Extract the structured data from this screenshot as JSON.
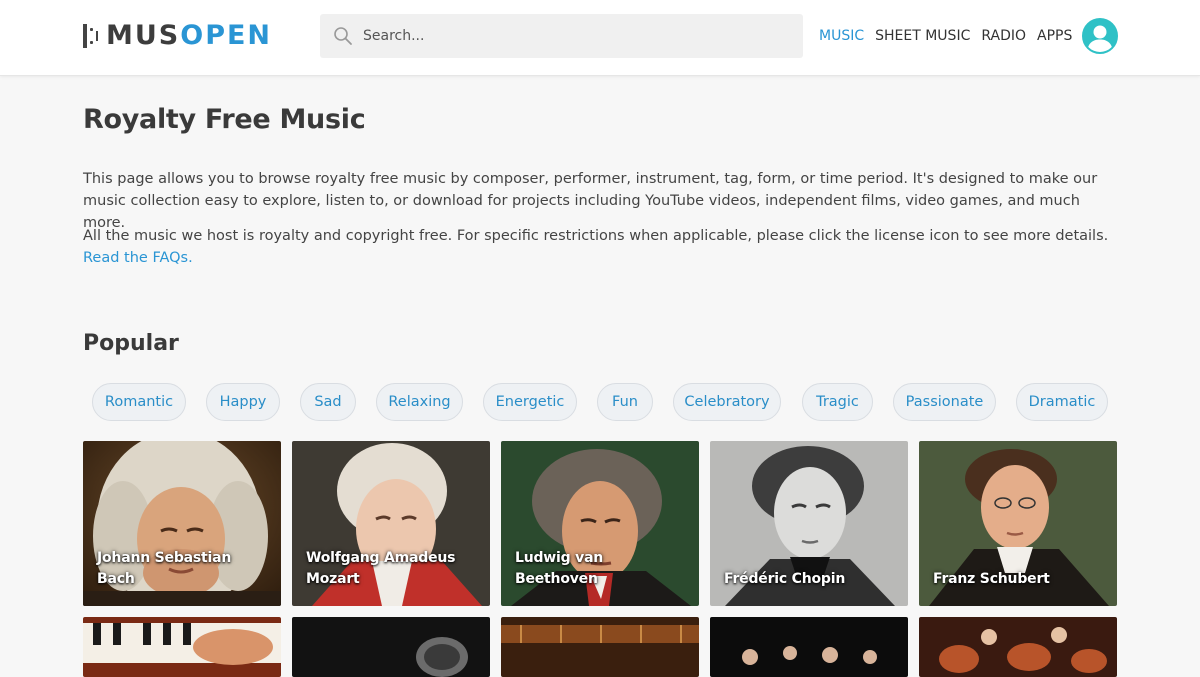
{
  "header": {
    "logo_mus": "MUS",
    "logo_open": "OPEN",
    "search_placeholder": "Search...",
    "nav": [
      {
        "label": "MUSIC",
        "active": true
      },
      {
        "label": "SHEET MUSIC",
        "active": false
      },
      {
        "label": "RADIO",
        "active": false
      },
      {
        "label": "APPS",
        "active": false
      }
    ]
  },
  "main": {
    "title": "Royalty Free Music",
    "paragraph1": "This page allows you to browse royalty free music by composer, performer, instrument, tag, form, or time period. It's designed to make our music collection easy to explore, listen to, or download for projects including YouTube videos, independent films, video games, and much more.",
    "paragraph2_text": "All the music we host is royalty and copyright free. For specific restrictions when applicable, please click the license icon to see more details. ",
    "paragraph2_link": "Read the FAQs.",
    "popular_title": "Popular",
    "tags": [
      "Romantic",
      "Happy",
      "Sad",
      "Relaxing",
      "Energetic",
      "Fun",
      "Celebratory",
      "Tragic",
      "Passionate",
      "Dramatic"
    ],
    "composers": [
      {
        "name": "Johann Sebastian Bach"
      },
      {
        "name": "Wolfgang Amadeus Mozart"
      },
      {
        "name": "Ludwig van Beethoven"
      },
      {
        "name": "Frédéric Chopin"
      },
      {
        "name": "Franz Schubert"
      }
    ]
  },
  "colors": {
    "accent": "#2a95d4",
    "avatar": "#2fc1c6",
    "tag_text": "#2a8ec8",
    "tag_bg": "#eef1f4"
  }
}
